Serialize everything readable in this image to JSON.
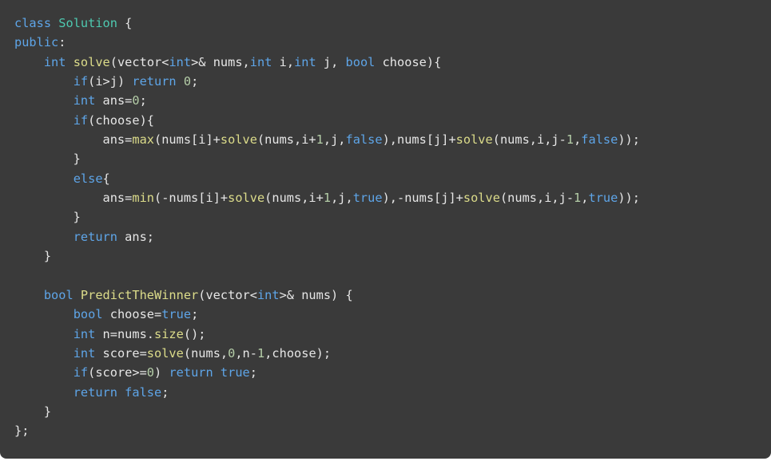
{
  "colors": {
    "background": "#3a3a3a",
    "page": "#ffffff",
    "text": "#e6e6e6",
    "keyword": "#5ea5e8",
    "class_name": "#4ec9b0",
    "function": "#dcdc8a",
    "number": "#b5cea8"
  },
  "code": {
    "language": "cpp",
    "lines": [
      [
        {
          "t": "kw",
          "v": "class"
        },
        {
          "t": "p",
          "v": " "
        },
        {
          "t": "cls",
          "v": "Solution"
        },
        {
          "t": "p",
          "v": " {"
        }
      ],
      [
        {
          "t": "kw",
          "v": "public"
        },
        {
          "t": "p",
          "v": ":"
        }
      ],
      [
        {
          "t": "p",
          "v": "    "
        },
        {
          "t": "kw",
          "v": "int"
        },
        {
          "t": "p",
          "v": " "
        },
        {
          "t": "fn",
          "v": "solve"
        },
        {
          "t": "p",
          "v": "(vector<"
        },
        {
          "t": "kw",
          "v": "int"
        },
        {
          "t": "p",
          "v": ">& nums,"
        },
        {
          "t": "kw",
          "v": "int"
        },
        {
          "t": "p",
          "v": " i,"
        },
        {
          "t": "kw",
          "v": "int"
        },
        {
          "t": "p",
          "v": " j, "
        },
        {
          "t": "kw",
          "v": "bool"
        },
        {
          "t": "p",
          "v": " choose){"
        }
      ],
      [
        {
          "t": "p",
          "v": "        "
        },
        {
          "t": "kw",
          "v": "if"
        },
        {
          "t": "p",
          "v": "(i>j) "
        },
        {
          "t": "kw",
          "v": "return"
        },
        {
          "t": "p",
          "v": " "
        },
        {
          "t": "num",
          "v": "0"
        },
        {
          "t": "p",
          "v": ";"
        }
      ],
      [
        {
          "t": "p",
          "v": "        "
        },
        {
          "t": "kw",
          "v": "int"
        },
        {
          "t": "p",
          "v": " ans="
        },
        {
          "t": "num",
          "v": "0"
        },
        {
          "t": "p",
          "v": ";"
        }
      ],
      [
        {
          "t": "p",
          "v": "        "
        },
        {
          "t": "kw",
          "v": "if"
        },
        {
          "t": "p",
          "v": "(choose){"
        }
      ],
      [
        {
          "t": "p",
          "v": "            ans="
        },
        {
          "t": "fn",
          "v": "max"
        },
        {
          "t": "p",
          "v": "(nums[i]+"
        },
        {
          "t": "fn",
          "v": "solve"
        },
        {
          "t": "p",
          "v": "(nums,i+"
        },
        {
          "t": "num",
          "v": "1"
        },
        {
          "t": "p",
          "v": ",j,"
        },
        {
          "t": "kw",
          "v": "false"
        },
        {
          "t": "p",
          "v": "),nums[j]+"
        },
        {
          "t": "fn",
          "v": "solve"
        },
        {
          "t": "p",
          "v": "(nums,i,j-"
        },
        {
          "t": "num",
          "v": "1"
        },
        {
          "t": "p",
          "v": ","
        },
        {
          "t": "kw",
          "v": "false"
        },
        {
          "t": "p",
          "v": "));"
        }
      ],
      [
        {
          "t": "p",
          "v": "        }"
        }
      ],
      [
        {
          "t": "p",
          "v": "        "
        },
        {
          "t": "kw",
          "v": "else"
        },
        {
          "t": "p",
          "v": "{"
        }
      ],
      [
        {
          "t": "p",
          "v": "            ans="
        },
        {
          "t": "fn",
          "v": "min"
        },
        {
          "t": "p",
          "v": "(-nums[i]+"
        },
        {
          "t": "fn",
          "v": "solve"
        },
        {
          "t": "p",
          "v": "(nums,i+"
        },
        {
          "t": "num",
          "v": "1"
        },
        {
          "t": "p",
          "v": ",j,"
        },
        {
          "t": "kw",
          "v": "true"
        },
        {
          "t": "p",
          "v": "),-nums[j]+"
        },
        {
          "t": "fn",
          "v": "solve"
        },
        {
          "t": "p",
          "v": "(nums,i,j-"
        },
        {
          "t": "num",
          "v": "1"
        },
        {
          "t": "p",
          "v": ","
        },
        {
          "t": "kw",
          "v": "true"
        },
        {
          "t": "p",
          "v": "));"
        }
      ],
      [
        {
          "t": "p",
          "v": "        }"
        }
      ],
      [
        {
          "t": "p",
          "v": "        "
        },
        {
          "t": "kw",
          "v": "return"
        },
        {
          "t": "p",
          "v": " ans;"
        }
      ],
      [
        {
          "t": "p",
          "v": "    }"
        }
      ],
      [],
      [
        {
          "t": "p",
          "v": "    "
        },
        {
          "t": "kw",
          "v": "bool"
        },
        {
          "t": "p",
          "v": " "
        },
        {
          "t": "fn",
          "v": "PredictTheWinner"
        },
        {
          "t": "p",
          "v": "(vector<"
        },
        {
          "t": "kw",
          "v": "int"
        },
        {
          "t": "p",
          "v": ">& nums) {"
        }
      ],
      [
        {
          "t": "p",
          "v": "        "
        },
        {
          "t": "kw",
          "v": "bool"
        },
        {
          "t": "p",
          "v": " choose="
        },
        {
          "t": "kw",
          "v": "true"
        },
        {
          "t": "p",
          "v": ";"
        }
      ],
      [
        {
          "t": "p",
          "v": "        "
        },
        {
          "t": "kw",
          "v": "int"
        },
        {
          "t": "p",
          "v": " n=nums."
        },
        {
          "t": "fn",
          "v": "size"
        },
        {
          "t": "p",
          "v": "();"
        }
      ],
      [
        {
          "t": "p",
          "v": "        "
        },
        {
          "t": "kw",
          "v": "int"
        },
        {
          "t": "p",
          "v": " score="
        },
        {
          "t": "fn",
          "v": "solve"
        },
        {
          "t": "p",
          "v": "(nums,"
        },
        {
          "t": "num",
          "v": "0"
        },
        {
          "t": "p",
          "v": ",n-"
        },
        {
          "t": "num",
          "v": "1"
        },
        {
          "t": "p",
          "v": ",choose);"
        }
      ],
      [
        {
          "t": "p",
          "v": "        "
        },
        {
          "t": "kw",
          "v": "if"
        },
        {
          "t": "p",
          "v": "(score>="
        },
        {
          "t": "num",
          "v": "0"
        },
        {
          "t": "p",
          "v": ") "
        },
        {
          "t": "kw",
          "v": "return"
        },
        {
          "t": "p",
          "v": " "
        },
        {
          "t": "kw",
          "v": "true"
        },
        {
          "t": "p",
          "v": ";"
        }
      ],
      [
        {
          "t": "p",
          "v": "        "
        },
        {
          "t": "kw",
          "v": "return"
        },
        {
          "t": "p",
          "v": " "
        },
        {
          "t": "kw",
          "v": "false"
        },
        {
          "t": "p",
          "v": ";"
        }
      ],
      [
        {
          "t": "p",
          "v": "    }"
        }
      ],
      [
        {
          "t": "p",
          "v": "};"
        }
      ]
    ]
  }
}
